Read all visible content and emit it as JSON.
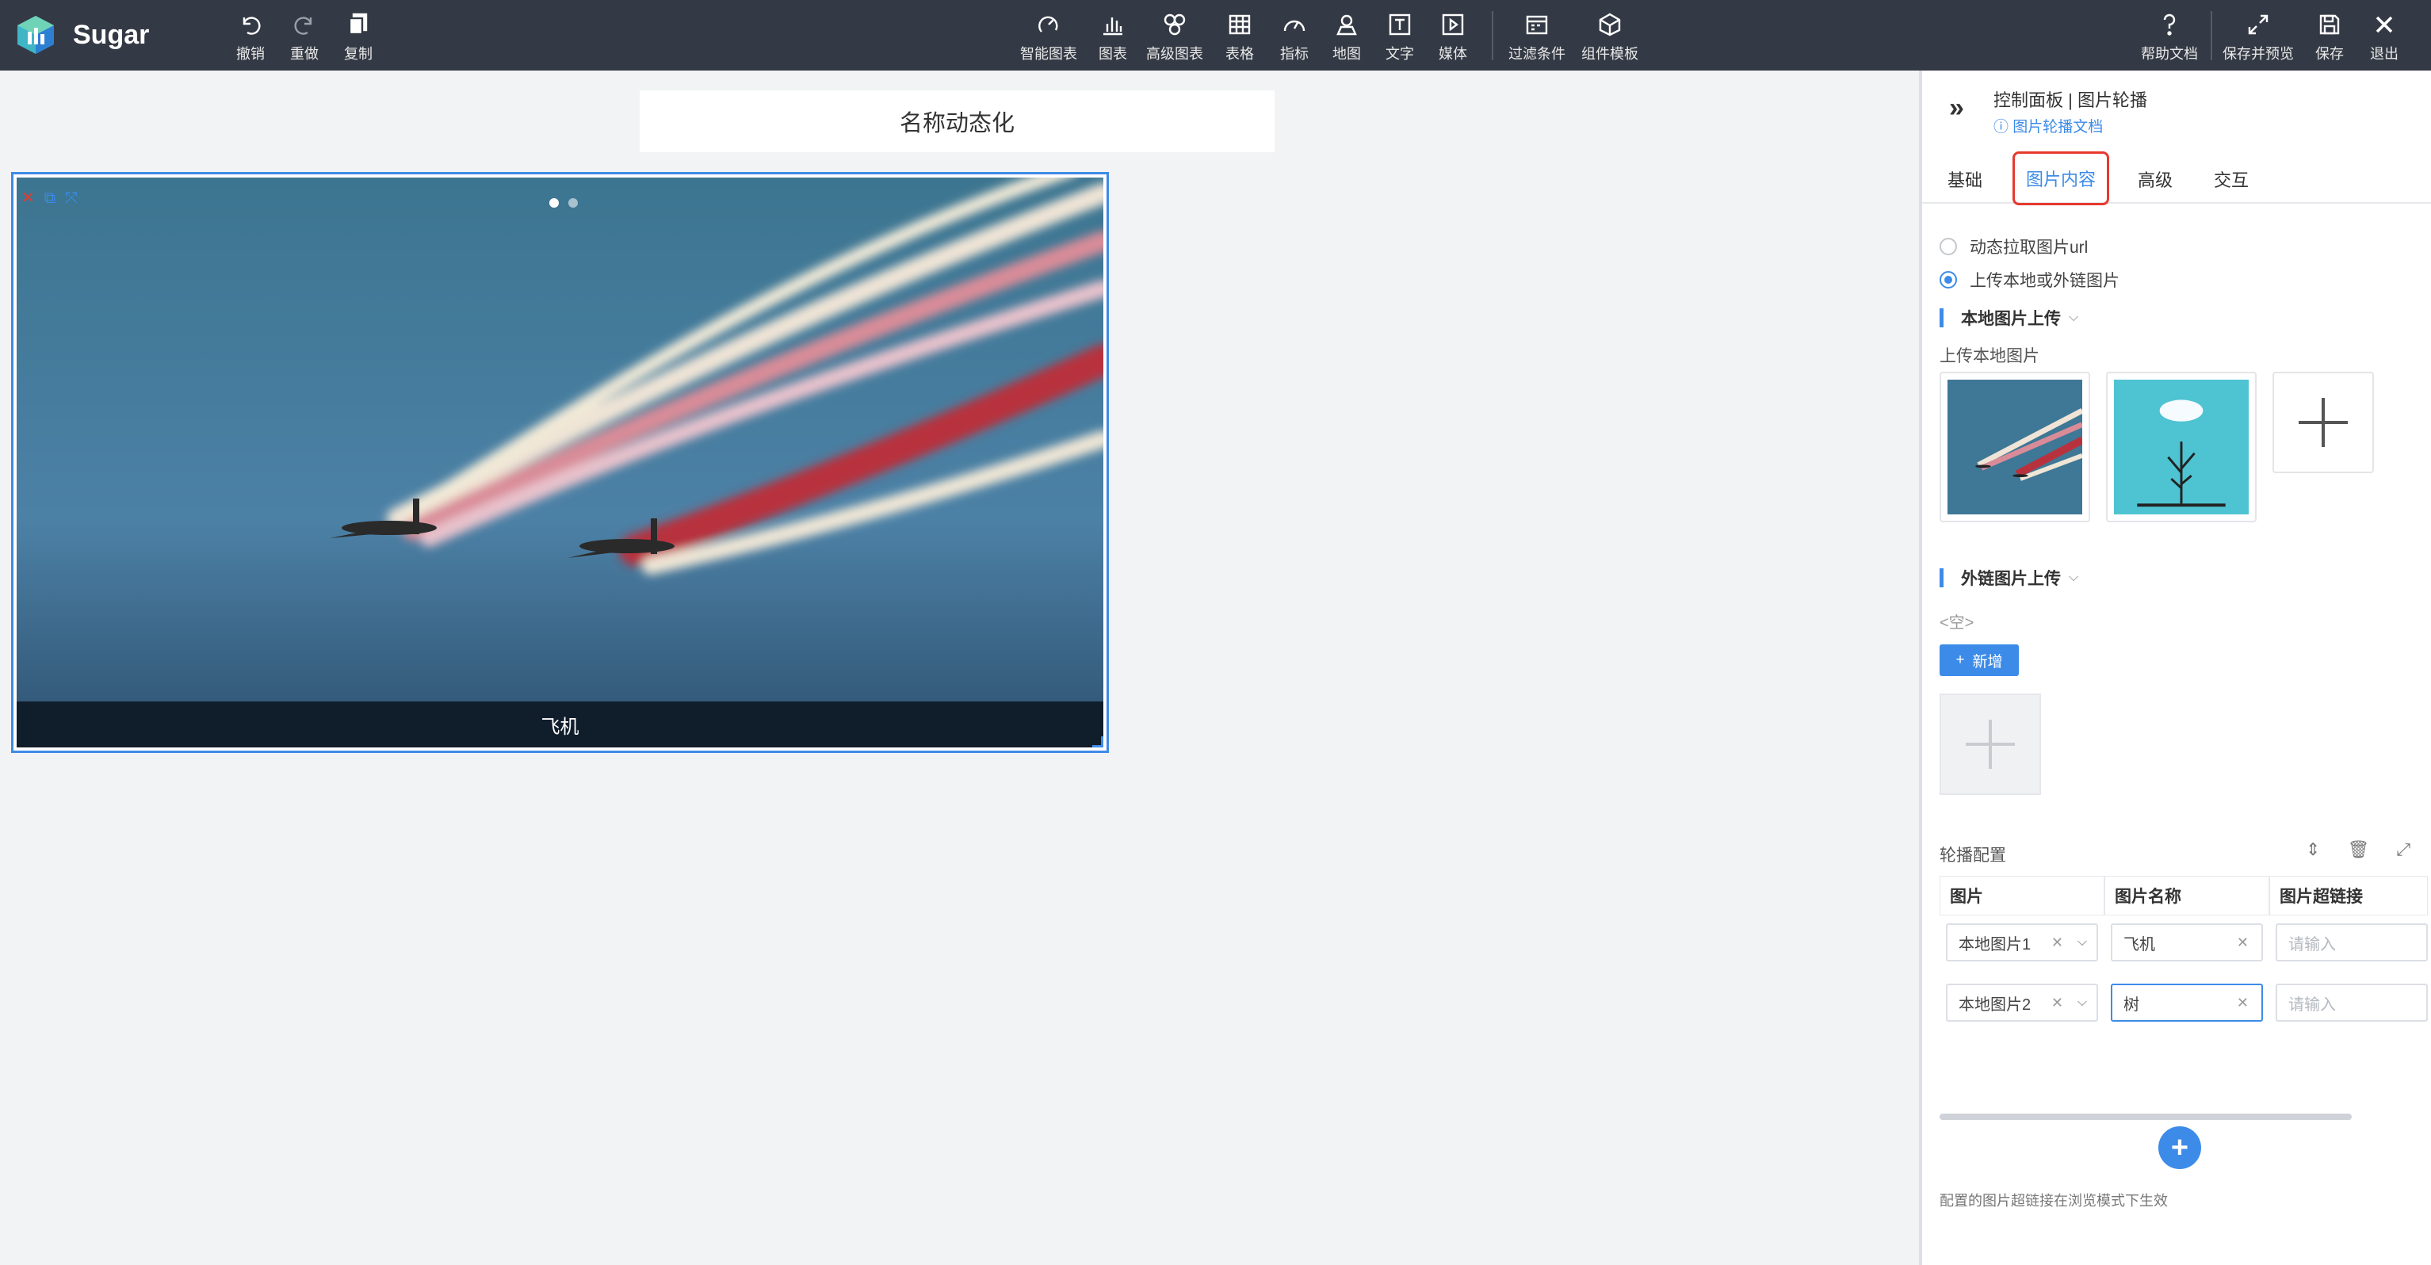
{
  "app": {
    "name": "Sugar"
  },
  "toolbar": {
    "undo": "撤销",
    "redo": "重做",
    "copy": "复制",
    "smart_chart": "智能图表",
    "chart": "图表",
    "advanced_chart": "高级图表",
    "table": "表格",
    "indicator": "指标",
    "map": "地图",
    "text": "文字",
    "media": "媒体",
    "filter": "过滤条件",
    "component_template": "组件模板",
    "help_doc": "帮助文档",
    "save_preview": "保存并预览",
    "save": "保存",
    "exit": "退出"
  },
  "canvas": {
    "title": "名称动态化",
    "carousel": {
      "caption": "飞机",
      "slide_count": 2,
      "active_slide": 1
    }
  },
  "panel": {
    "breadcrumb": "控制面板 | 图片轮播",
    "doc_link": "图片轮播文档",
    "tabs": [
      "基础",
      "图片内容",
      "高级",
      "交互"
    ],
    "active_tab": "图片内容",
    "source_options": {
      "dynamic": "动态拉取图片url",
      "upload": "上传本地或外链图片",
      "selected": "上传本地或外链图片"
    },
    "local_section": {
      "title": "本地图片上传",
      "sub_label": "上传本地图片"
    },
    "external_section": {
      "title": "外链图片上传",
      "empty": "<空>",
      "add_label": "新增"
    },
    "carousel_config": {
      "label": "轮播配置",
      "columns": [
        "图片",
        "图片名称",
        "图片超链接"
      ],
      "rows": [
        {
          "image": "本地图片1",
          "name": "飞机",
          "link_placeholder": "请输入"
        },
        {
          "image": "本地图片2",
          "name": "树",
          "link_placeholder": "请输入"
        }
      ]
    },
    "footnote": "配置的图片超链接在浏览模式下生效"
  },
  "colors": {
    "topbar": "#343a45",
    "accent": "#3d8be8",
    "highlight": "#e8392e"
  }
}
